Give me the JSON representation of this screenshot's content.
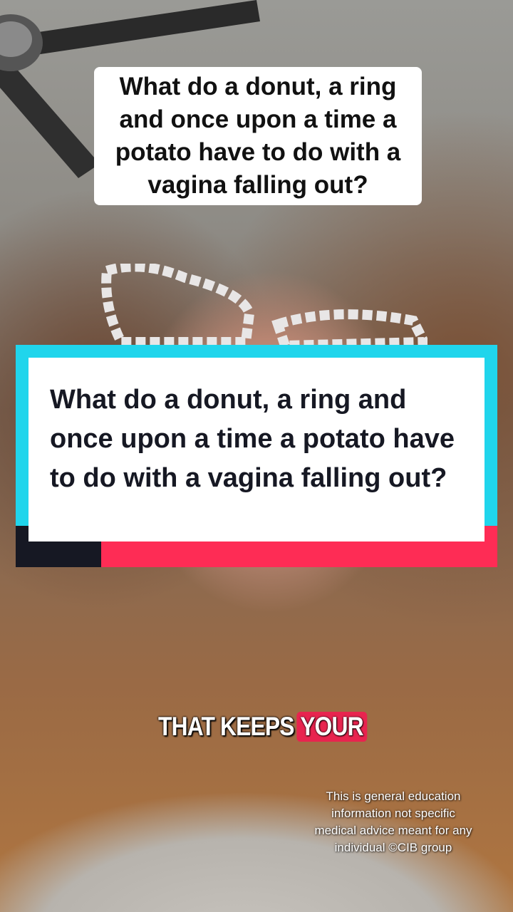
{
  "overlay_top": {
    "text": "What do a donut, a ring and once upon a time a potato have to do with a vagina falling out?"
  },
  "title_card": {
    "text": "What do a donut, a ring and once upon a time a potato have to do with a vagina falling out?",
    "colors": {
      "cyan": "#20d5ec",
      "red": "#fe2c55",
      "navy": "#161823",
      "panel": "#ffffff"
    }
  },
  "subtitle": {
    "plain": "THAT KEEPS",
    "highlight": "YOUR",
    "highlight_color": "#e8244f"
  },
  "disclaimer": {
    "text": "This is  general education information not specific medical advice meant for any individual  ©CIB group"
  }
}
